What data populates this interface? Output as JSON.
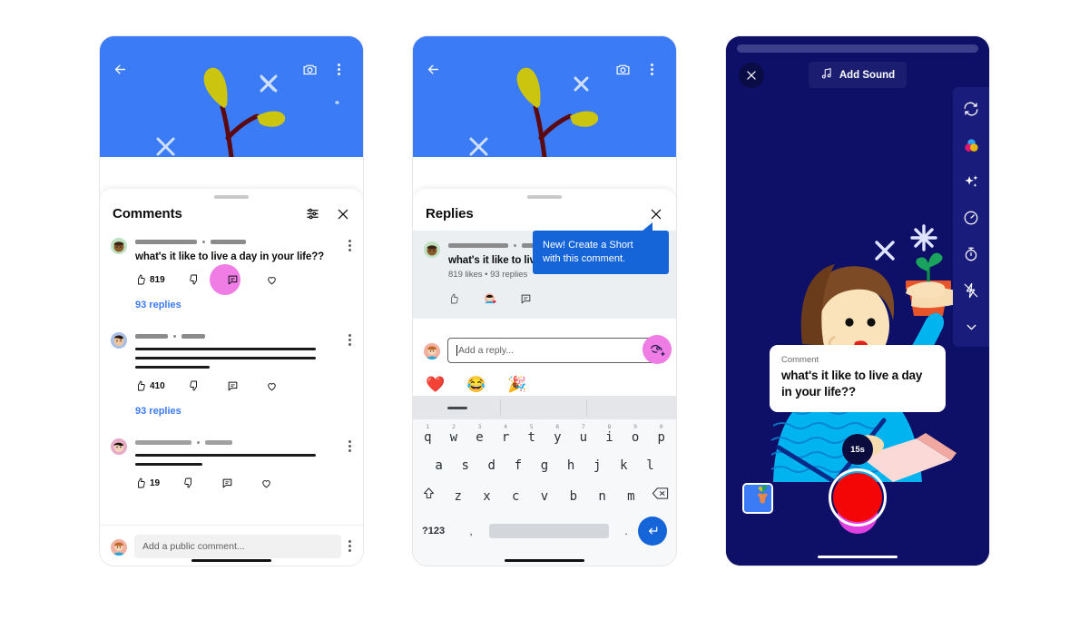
{
  "colors": {
    "brand_blue": "#3b7bf5",
    "pink_highlight": "#f07ce6",
    "tooltip_blue": "#1565d8",
    "shorts_bg": "#0d1066",
    "rail_bg": "#191c7a",
    "record_red": "#f40606",
    "record_cursor": "#e040e0"
  },
  "panel1": {
    "name": "comments-sheet",
    "hero": {
      "back_icon": "back-arrow-icon",
      "camera_icon": "camera-icon",
      "overflow_icon": "kebab-menu-icon"
    },
    "header": {
      "title": "Comments",
      "sort_icon": "sort-filter-icon",
      "close_icon": "close-icon"
    },
    "comments": [
      {
        "text": "what's it like to live a day in your life??",
        "like_count": "819",
        "replies_label": "93 replies",
        "highlighted_action": "reply-icon",
        "text_lines": 0
      },
      {
        "text": "",
        "like_count": "410",
        "replies_label": "93 replies",
        "text_lines": 3
      },
      {
        "text": "",
        "like_count": "19",
        "replies_label": "",
        "text_lines": 2
      }
    ],
    "composer": {
      "placeholder": "Add a public comment...",
      "overflow_icon": "kebab-menu-icon"
    }
  },
  "panel2": {
    "name": "replies-sheet",
    "hero": {
      "back_icon": "back-arrow-icon",
      "camera_icon": "camera-icon",
      "overflow_icon": "kebab-menu-icon"
    },
    "header": {
      "title": "Replies",
      "close_icon": "close-icon"
    },
    "parent_comment": {
      "text": "what's it like to live a day in your life??",
      "stats": "819 likes • 93 replies",
      "actions": [
        "like-icon",
        "creator-heart-icon",
        "reply-icon"
      ],
      "overflow_icon": "kebab-menu-icon"
    },
    "reply_bar": {
      "placeholder": "Add a reply...",
      "short_button_icon": "create-short-icon"
    },
    "emoji_row": [
      "❤️",
      "😂",
      "🎉"
    ],
    "tooltip": {
      "line1": "New! Create a Short",
      "line2": "with this comment."
    },
    "keyboard": {
      "row1": [
        {
          "letter": "q",
          "num": "1"
        },
        {
          "letter": "w",
          "num": "2"
        },
        {
          "letter": "e",
          "num": "3"
        },
        {
          "letter": "r",
          "num": "4"
        },
        {
          "letter": "t",
          "num": "5"
        },
        {
          "letter": "y",
          "num": "6"
        },
        {
          "letter": "u",
          "num": "7"
        },
        {
          "letter": "i",
          "num": "8"
        },
        {
          "letter": "o",
          "num": "9"
        },
        {
          "letter": "p",
          "num": "0"
        }
      ],
      "row2": [
        "a",
        "s",
        "d",
        "f",
        "g",
        "h",
        "j",
        "k",
        "l"
      ],
      "row3": [
        "z",
        "x",
        "c",
        "v",
        "b",
        "n",
        "m"
      ],
      "shift_icon": "shift-up-arrow-icon",
      "backspace_icon": "backspace-icon",
      "symbols_key": "?123",
      "comma_key": ",",
      "period_key": ".",
      "enter_icon": "enter-return-icon"
    }
  },
  "panel3": {
    "name": "shorts-camera",
    "top_bar": {
      "close_icon": "close-icon",
      "add_sound_label": "Add Sound",
      "music_note_icon": "music-note-icon",
      "flip_camera_icon": "flip-camera-icon"
    },
    "side_rail": [
      {
        "icon": "flip-camera-icon",
        "label": "Flip"
      },
      {
        "icon": "filters-color-circles-icon",
        "label": "Filters"
      },
      {
        "icon": "effects-sparkle-icon",
        "label": "Effects"
      },
      {
        "icon": "speed-gauge-icon",
        "label": "Speed"
      },
      {
        "icon": "timer-icon",
        "label": "Timer"
      },
      {
        "icon": "flash-off-icon",
        "label": "Flash off"
      },
      {
        "icon": "chevron-down-icon",
        "label": "More"
      }
    ],
    "comment_card": {
      "label": "Comment",
      "text": "what's it like to live a day in your life??"
    },
    "duration_badge": "15s",
    "record_button_icon": "record-button",
    "gallery_icon": "gallery-thumbnail"
  }
}
